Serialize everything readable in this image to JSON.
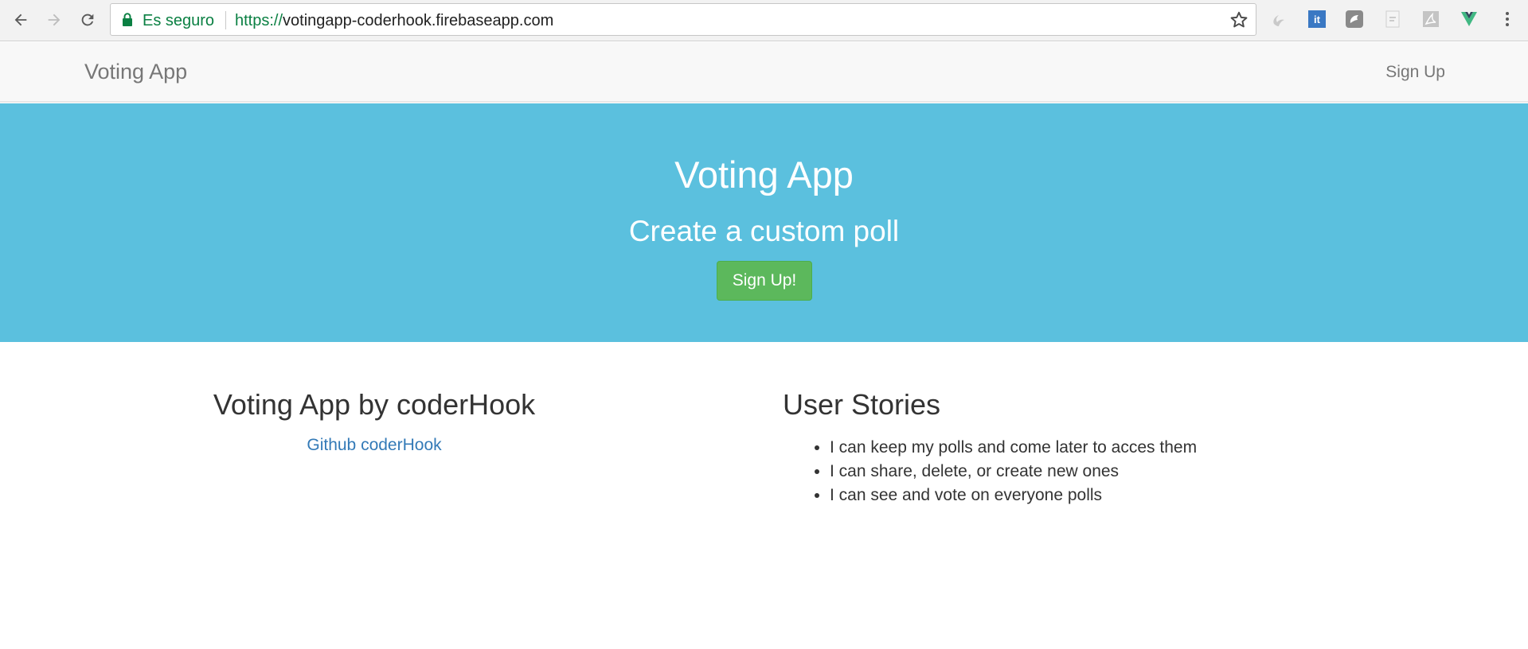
{
  "browser": {
    "secure_label": "Es seguro",
    "url_scheme": "https://",
    "url_host": "votingapp-coderhook.firebaseapp.com",
    "extensions": [
      {
        "icon": "swirl-extension-icon"
      },
      {
        "icon": "it-extension-icon",
        "text": "it"
      },
      {
        "icon": "chat-extension-icon"
      },
      {
        "icon": "page-extension-icon"
      },
      {
        "icon": "pdf-extension-icon"
      },
      {
        "icon": "vue-devtools-icon"
      }
    ]
  },
  "navbar": {
    "brand": "Voting App",
    "signup": "Sign Up"
  },
  "hero": {
    "title": "Voting App",
    "subtitle": "Create a custom poll",
    "button": "Sign Up!"
  },
  "about": {
    "heading": "Voting App by coderHook",
    "link": "Github coderHook"
  },
  "stories": {
    "heading": "User Stories",
    "items": [
      "I can keep my polls and come later to acces them",
      "I can share, delete, or create new ones",
      "I can see and vote on everyone polls"
    ]
  },
  "colors": {
    "hero_bg": "#5bc0de",
    "success": "#5cb85c",
    "link": "#337ab7",
    "secure_green": "#0b8043"
  }
}
